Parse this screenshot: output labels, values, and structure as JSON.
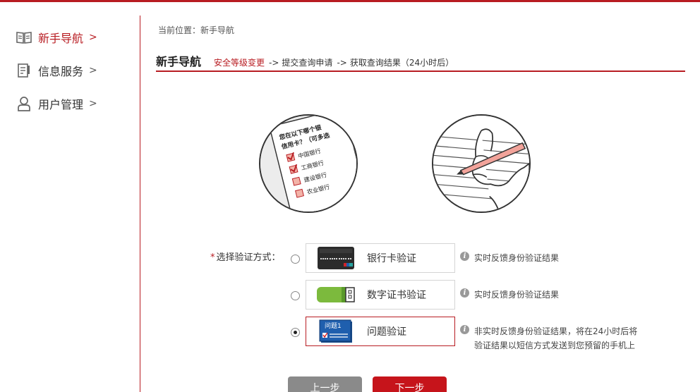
{
  "sidebar": {
    "items": [
      {
        "label": "新手导航",
        "arrow": ">",
        "icon": "book-icon",
        "active": true
      },
      {
        "label": "信息服务",
        "arrow": ">",
        "icon": "document-icon",
        "active": false
      },
      {
        "label": "用户管理",
        "arrow": ">",
        "icon": "user-icon",
        "active": false
      }
    ]
  },
  "breadcrumb": {
    "prefix": "当前位置：",
    "current": "新手导航"
  },
  "header": {
    "title": "新手导航",
    "steps": [
      {
        "label": "安全等级变更",
        "current": true
      },
      {
        "sep": "->",
        "label": "提交查询申请",
        "current": false
      },
      {
        "sep": "->",
        "label": "获取查询结果（24小时后）",
        "current": false
      }
    ]
  },
  "illustrations": {
    "left": {
      "lines": [
        "您在以下哪个银",
        "信用卡？（可多选",
        "中国银行",
        "工商银行",
        "建设银行",
        "农业银行"
      ]
    }
  },
  "verify": {
    "label": "选择验证方式：",
    "required_mark": "*",
    "options": [
      {
        "label": "银行卡验证",
        "icon": "bank-card-icon",
        "checked": false,
        "hint": [
          "实时反馈身份验证结果"
        ]
      },
      {
        "label": "数字证书验证",
        "icon": "usb-key-icon",
        "checked": false,
        "hint": [
          "实时反馈身份验证结果"
        ]
      },
      {
        "label": "问题验证",
        "icon": "question-card-icon",
        "card_text": "问题1",
        "checked": true,
        "hint": [
          "非实时反馈身份验证结果，将在24小时后将",
          "验证结果以短信方式发送到您预留的手机上"
        ]
      }
    ]
  },
  "buttons": {
    "prev": "上一步",
    "next": "下一步"
  },
  "colors": {
    "accent": "#b81c22",
    "next_button": "#c6141b",
    "prev_button": "#8a8a8a",
    "usb_green": "#7cba3d",
    "question_blue": "#1f5fae"
  }
}
